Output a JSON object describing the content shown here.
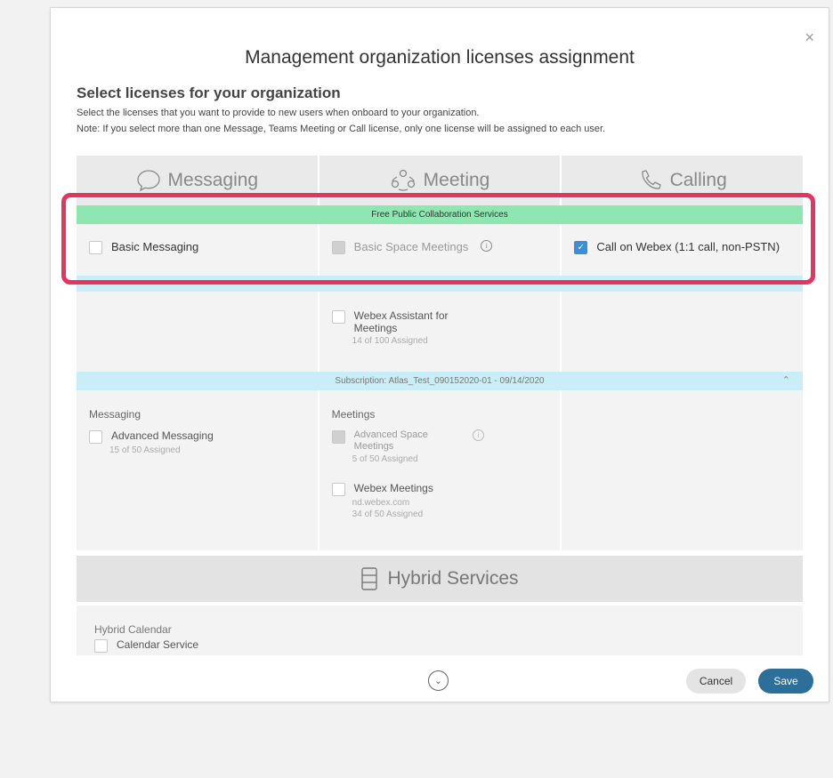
{
  "dialog": {
    "title": "Management organization licenses assignment",
    "subtitle": "Select licenses for your organization",
    "description": "Select the licenses that you want to provide to new users when onboard to your organization.",
    "note": "Note: If you select more than one Message, Teams Meeting or Call license, only one license will be assigned to each user.",
    "close_icon": "×"
  },
  "columns": [
    {
      "label": "Messaging",
      "icon": "chat-bubble-icon"
    },
    {
      "label": "Meeting",
      "icon": "people-icon"
    },
    {
      "label": "Calling",
      "icon": "phone-icon"
    }
  ],
  "free_services": {
    "band_label": "Free Public Collaboration Services",
    "basic_messaging": {
      "label": "Basic Messaging",
      "checked": false
    },
    "basic_space_meetings": {
      "label": "Basic Space Meetings",
      "disabled": true
    },
    "call_on_webex": {
      "label": "Call on Webex (1:1 call, non-PSTN)",
      "checked": true
    }
  },
  "first_subscription": {
    "assistant": {
      "label": "Webex Assistant for",
      "label2": "Meetings",
      "count": "14 of 100 Assigned"
    }
  },
  "subscription": {
    "band_label": "Subscription: Atlas_Test_090152020-01 - 09/14/2020",
    "messaging_group": "Messaging",
    "advanced_messaging": {
      "label": "Advanced Messaging",
      "count": "15 of 50 Assigned"
    },
    "meetings_group": "Meetings",
    "advanced_space": {
      "label": "Advanced Space",
      "label2": "Meetings",
      "count": "5 of 50 Assigned"
    },
    "webex_meetings": {
      "label": "Webex Meetings",
      "site": "nd.webex.com",
      "count": "34 of 50 Assigned"
    }
  },
  "hybrid": {
    "title": "Hybrid Services",
    "icon": "server-icon",
    "calendar_group": "Hybrid Calendar",
    "calendar_service": "Calendar Service"
  },
  "footer": {
    "cancel": "Cancel",
    "save": "Save",
    "scroll_icon": "chevron-down-circle-icon"
  },
  "colors": {
    "highlight": "#e5345e",
    "free_band": "#8ee6b0",
    "sub_band": "#c9eef8",
    "save": "#2c6f9b",
    "checkbox_on": "#3b8fd8"
  }
}
